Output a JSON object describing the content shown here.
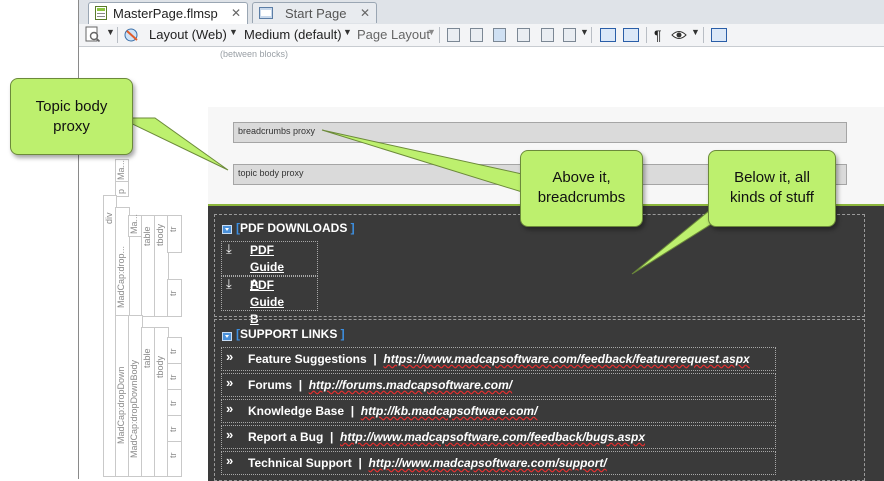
{
  "tabs": [
    {
      "label": "MasterPage.flmsp",
      "close": "✕",
      "active": true
    },
    {
      "label": "Start Page",
      "close": "✕",
      "active": false
    }
  ],
  "toolbar": {
    "layout": "Layout (Web)",
    "medium": "Medium (default)",
    "page_layout": "Page Layout"
  },
  "editor": {
    "between_blocks": "(between blocks)",
    "breadcrumbs_proxy": "breadcrumbs proxy",
    "topic_body_proxy": "topic body proxy"
  },
  "structure_bar": {
    "labels": [
      "Ma...",
      "p",
      "Ma...",
      "div",
      "MadCap:dropDown",
      "MadCap:drop...",
      "Ma...",
      "table",
      "tbody",
      "tr",
      "tr",
      "MadCap:dropDown",
      "MadCap:dropDownBody",
      "Ma...",
      "table",
      "tbody",
      "tr",
      "tr",
      "tr",
      "tr",
      "tr"
    ]
  },
  "pdf_section": {
    "title": "PDF DOWNLOADS",
    "items": [
      {
        "line1": "PDF Guide",
        "line2": "A",
        "icon": "download-icon"
      },
      {
        "line1": "PDF Guide",
        "line2": "B",
        "icon": "download-icon"
      }
    ]
  },
  "support_section": {
    "title": "SUPPORT LINKS",
    "rows": [
      {
        "name": "Feature Suggestions",
        "sep": "|",
        "url": "https://www.madcapsoftware.com/feedback/featurerequest.aspx"
      },
      {
        "name": "Forums",
        "sep": "|",
        "url": "http://forums.madcapsoftware.com/"
      },
      {
        "name": "Knowledge Base",
        "sep": "|",
        "url": "http://kb.madcapsoftware.com/"
      },
      {
        "name": "Report a Bug",
        "sep": "|",
        "url": "http://www.madcapsoftware.com/feedback/bugs.aspx"
      },
      {
        "name": "Technical Support",
        "sep": "|",
        "url": "http://www.madcapsoftware.com/support/"
      }
    ]
  },
  "callouts": {
    "topic_body": "Topic body proxy",
    "above": "Above it, breadcrumbs",
    "below": "Below it, all kinds of stuff"
  },
  "colors": {
    "callout_fill": "#bdf06e",
    "dark_area": "#3a3a3a",
    "accent_line": "#8cb63c",
    "bracket_blue": "#3d8fe0"
  }
}
